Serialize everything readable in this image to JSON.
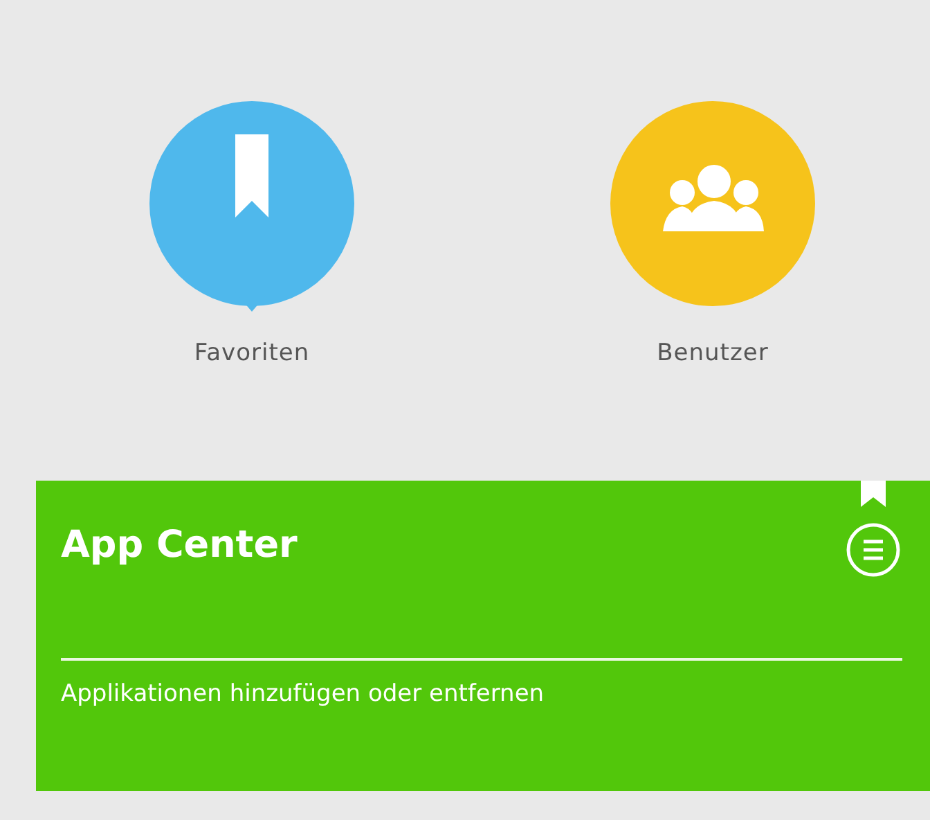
{
  "tiles": [
    {
      "label": "Favoriten",
      "kind": "bookmark",
      "color": "#4fb8ec"
    },
    {
      "label": "Benutzer",
      "kind": "people",
      "color": "#f6c31b"
    }
  ],
  "card": {
    "title": "App Center",
    "description": "Applikationen hinzufügen oder entfernen",
    "bookmarked": true
  }
}
